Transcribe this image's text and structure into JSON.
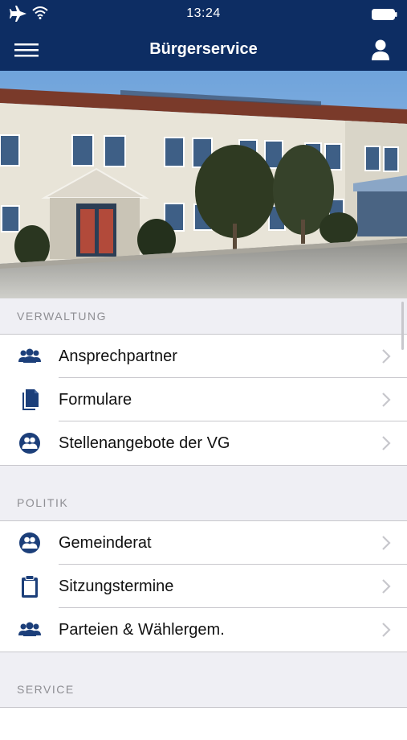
{
  "status": {
    "time": "13:24"
  },
  "navbar": {
    "title": "Bürgerservice"
  },
  "sections": [
    {
      "header": "VERWALTUNG",
      "items": [
        {
          "label": "Ansprechpartner",
          "icon": "group-icon"
        },
        {
          "label": "Formulare",
          "icon": "documents-icon"
        },
        {
          "label": "Stellenangebote der VG",
          "icon": "people-circle-icon"
        }
      ]
    },
    {
      "header": "POLITIK",
      "items": [
        {
          "label": "Gemeinderat",
          "icon": "people-circle-icon"
        },
        {
          "label": "Sitzungstermine",
          "icon": "clipboard-icon"
        },
        {
          "label": "Parteien & Wählergem.",
          "icon": "group-icon"
        }
      ]
    },
    {
      "header": "SERVICE",
      "items": []
    }
  ],
  "colors": {
    "navbar": "#0d2d63",
    "icon": "#1c3f7a",
    "chevron": "#c7c7cc"
  }
}
